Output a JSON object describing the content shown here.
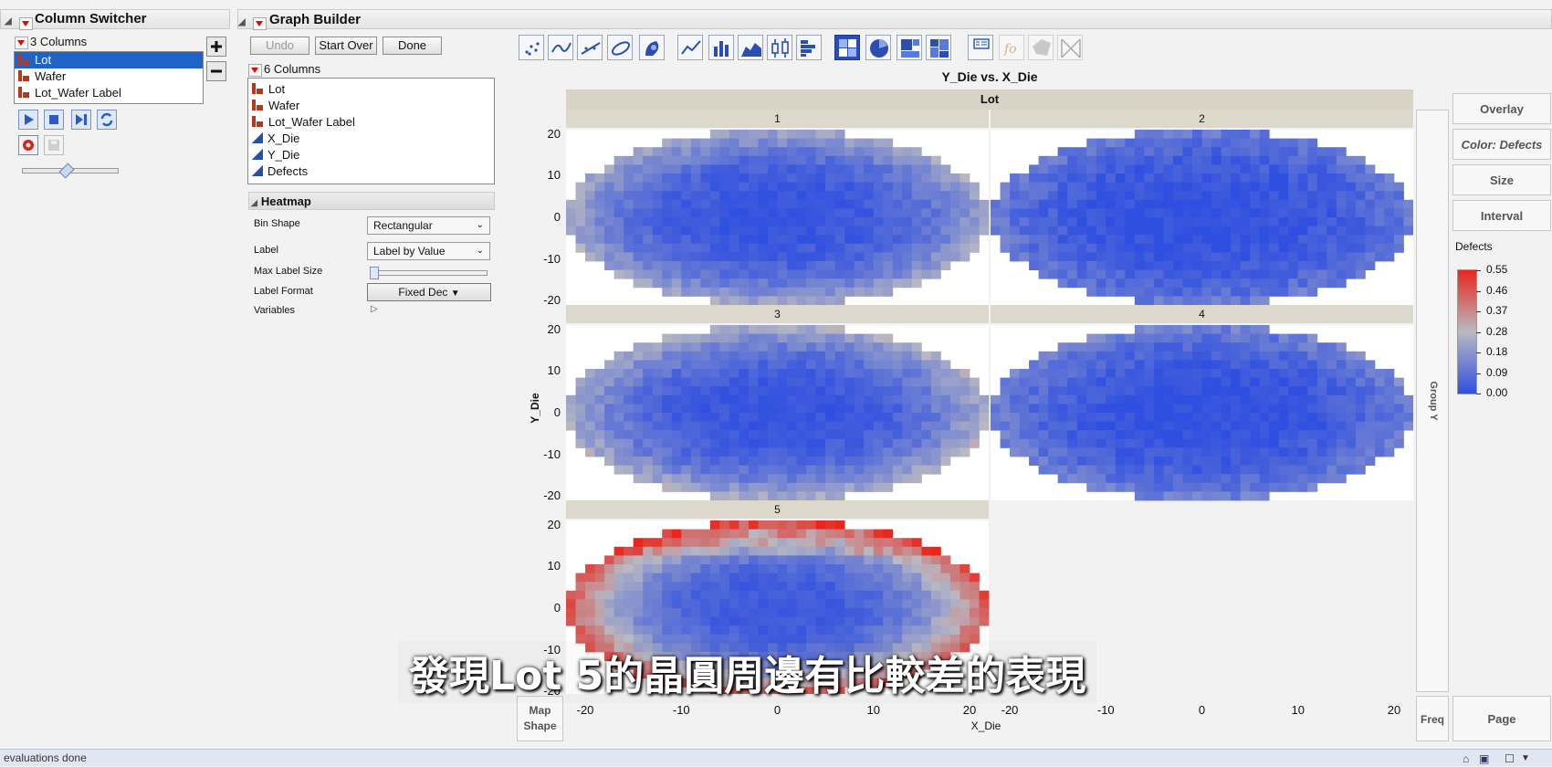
{
  "column_switcher": {
    "title": "Column Switcher",
    "count_label": "3 Columns",
    "items": [
      "Lot",
      "Wafer",
      "Lot_Wafer Label"
    ],
    "selected_index": 0,
    "add_icon": "plus-icon",
    "remove_icon": "minus-icon",
    "playback_icons": [
      "play-icon",
      "stop-icon",
      "step-icon",
      "loop-icon",
      "record-icon",
      "save-icon"
    ],
    "speed_slider_fraction": 0.45
  },
  "graph_builder": {
    "title": "Graph Builder",
    "buttons": {
      "undo": "Undo",
      "start_over": "Start Over",
      "done": "Done"
    },
    "columns_label": "6 Columns",
    "columns": [
      {
        "name": "Lot",
        "type": "nominal"
      },
      {
        "name": "Wafer",
        "type": "nominal"
      },
      {
        "name": "Lot_Wafer Label",
        "type": "nominal"
      },
      {
        "name": "X_Die",
        "type": "continuous"
      },
      {
        "name": "Y_Die",
        "type": "continuous"
      },
      {
        "name": "Defects",
        "type": "continuous"
      }
    ],
    "heatmap": {
      "title": "Heatmap",
      "bin_shape_label": "Bin Shape",
      "bin_shape_value": "Rectangular",
      "label_label": "Label",
      "label_value": "Label by Value",
      "max_label_size_label": "Max Label Size",
      "max_label_size_fraction": 0.0,
      "label_format_label": "Label Format",
      "label_format_value": "Fixed Dec",
      "variables_label": "Variables"
    },
    "toolbar_icons": [
      "points-icon",
      "smoother-icon",
      "line-of-fit-icon",
      "ellipse-icon",
      "contour-icon",
      "line-icon",
      "bar-icon",
      "area-icon",
      "box-plot-icon",
      "histogram-icon",
      "heatmap-icon",
      "pie-icon",
      "treemap-icon",
      "mosaic-icon",
      "caption-box-icon",
      "formula-icon",
      "map-shape-icon",
      "parallel-icon"
    ],
    "active_tool": "heatmap-icon",
    "zones": {
      "overlay": "Overlay",
      "color": "Color: Defects",
      "size": "Size",
      "interval": "Interval",
      "freq": "Freq",
      "page": "Page",
      "map_shape": "Map\nShape",
      "group_y": "Group Y"
    }
  },
  "chart_data": {
    "type": "heatmap",
    "title": "Y_Die vs. X_Die",
    "wrap_label": "Lot",
    "xlabel": "X_Die",
    "ylabel": "Y_Die",
    "xlim": [
      -22,
      22
    ],
    "ylim": [
      -21,
      21
    ],
    "x_ticks": [
      "-20",
      "-10",
      "0",
      "10",
      "20"
    ],
    "y_ticks": [
      "20",
      "10",
      "0",
      "-10",
      "-20"
    ],
    "panels": [
      {
        "name": "1",
        "edge_defect": 0.24,
        "center_defect": 0.02
      },
      {
        "name": "2",
        "edge_defect": 0.12,
        "center_defect": 0.01
      },
      {
        "name": "3",
        "edge_defect": 0.26,
        "center_defect": 0.02
      },
      {
        "name": "4",
        "edge_defect": 0.14,
        "center_defect": 0.01
      },
      {
        "name": "5",
        "edge_defect": 0.48,
        "center_defect": 0.03
      }
    ],
    "color_scale": {
      "label": "Defects",
      "ticks": [
        "0.55",
        "0.46",
        "0.37",
        "0.28",
        "0.18",
        "0.09",
        "0.00"
      ],
      "range": [
        0.0,
        0.55
      ],
      "colors": [
        "#2f4fe0",
        "#b9b9c2",
        "#e8261c"
      ]
    }
  },
  "caption_text": "發現Lot 5的晶圓周邊有比較差的表現",
  "status_text": "evaluations done"
}
